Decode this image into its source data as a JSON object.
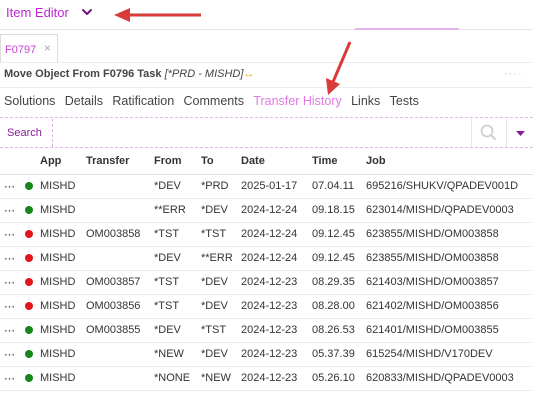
{
  "header": {
    "app_title": "Item Editor",
    "accent_color": "#c224d6"
  },
  "object_tab": {
    "label": "F0797",
    "close_glyph": "×"
  },
  "task": {
    "title": "Move Object From F0796 Task",
    "environment": "[*PRD - MISHD]",
    "swap_glyph": "↔",
    "more_glyph": "····"
  },
  "subtabs": [
    {
      "label": "Solutions",
      "active": false
    },
    {
      "label": "Details",
      "active": false
    },
    {
      "label": "Ratification",
      "active": false
    },
    {
      "label": "Comments",
      "active": false
    },
    {
      "label": "Transfer History",
      "active": true
    },
    {
      "label": "Links",
      "active": false
    },
    {
      "label": "Tests",
      "active": false
    }
  ],
  "search": {
    "label": "Search",
    "placeholder": ""
  },
  "table": {
    "headers": {
      "app": "App",
      "transfer": "Transfer",
      "from": "From",
      "to": "To",
      "date": "Date",
      "time": "Time",
      "job": "Job"
    },
    "rows": [
      {
        "status": "green",
        "app": "MISHD",
        "transfer": "",
        "from": "*DEV",
        "to": "*PRD",
        "date": "2025-01-17",
        "time": "07.04.11",
        "job": "695216/SHUKV/QPADEV001D"
      },
      {
        "status": "green",
        "app": "MISHD",
        "transfer": "",
        "from": "**ERR",
        "to": "*DEV",
        "date": "2024-12-24",
        "time": "09.18.15",
        "job": "623014/MISHD/QPADEV0003"
      },
      {
        "status": "red",
        "app": "MISHD",
        "transfer": "OM003858",
        "from": "*TST",
        "to": "*TST",
        "date": "2024-12-24",
        "time": "09.12.45",
        "job": "623855/MISHD/OM003858"
      },
      {
        "status": "red",
        "app": "MISHD",
        "transfer": "",
        "from": "*DEV",
        "to": "**ERR",
        "date": "2024-12-24",
        "time": "09.12.45",
        "job": "623855/MISHD/OM003858"
      },
      {
        "status": "red",
        "app": "MISHD",
        "transfer": "OM003857",
        "from": "*TST",
        "to": "*DEV",
        "date": "2024-12-23",
        "time": "08.29.35",
        "job": "621403/MISHD/OM003857"
      },
      {
        "status": "red",
        "app": "MISHD",
        "transfer": "OM003856",
        "from": "*TST",
        "to": "*DEV",
        "date": "2024-12-23",
        "time": "08.28.00",
        "job": "621402/MISHD/OM003856"
      },
      {
        "status": "green",
        "app": "MISHD",
        "transfer": "OM003855",
        "from": "*DEV",
        "to": "*TST",
        "date": "2024-12-23",
        "time": "08.26.53",
        "job": "621401/MISHD/OM003855"
      },
      {
        "status": "green",
        "app": "MISHD",
        "transfer": "",
        "from": "*NEW",
        "to": "*DEV",
        "date": "2024-12-23",
        "time": "05.37.39",
        "job": "615254/MISHD/V170DEV"
      },
      {
        "status": "green",
        "app": "MISHD",
        "transfer": "",
        "from": "*NONE",
        "to": "*NEW",
        "date": "2024-12-23",
        "time": "05.26.10",
        "job": "620833/MISHD/QPADEV0003"
      }
    ]
  },
  "colors": {
    "green": "#14891c",
    "red": "#e0161b",
    "annotation_arrow": "#d93a3a"
  },
  "icons": {
    "chevron": "chevron-down-icon",
    "search": "search-icon",
    "dropdown": "caret-down-icon",
    "drag": "drag-handle-icon"
  }
}
